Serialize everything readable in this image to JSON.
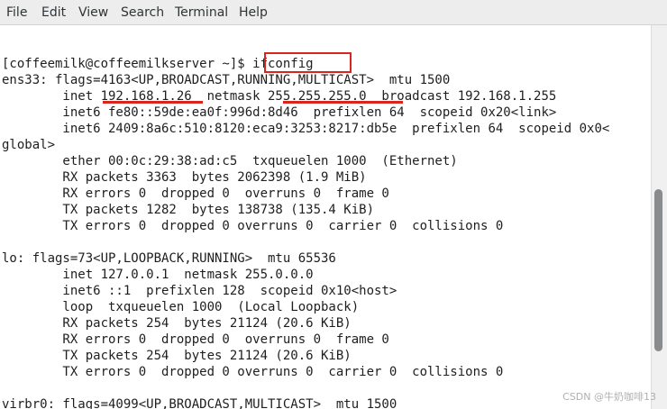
{
  "menubar": {
    "items": [
      "File",
      "Edit",
      "View",
      "Search",
      "Terminal",
      "Help"
    ]
  },
  "terminal": {
    "lines": [
      "",
      "[coffeemilk@coffeemilkserver ~]$ ifconfig",
      "ens33: flags=4163<UP,BROADCAST,RUNNING,MULTICAST>  mtu 1500",
      "        inet 192.168.1.26  netmask 255.255.255.0  broadcast 192.168.1.255",
      "        inet6 fe80::59de:ea0f:996d:8d46  prefixlen 64  scopeid 0x20<link>",
      "        inet6 2409:8a6c:510:8120:eca9:3253:8217:db5e  prefixlen 64  scopeid 0x0<",
      "global>",
      "        ether 00:0c:29:38:ad:c5  txqueuelen 1000  (Ethernet)",
      "        RX packets 3363  bytes 2062398 (1.9 MiB)",
      "        RX errors 0  dropped 0  overruns 0  frame 0",
      "        TX packets 1282  bytes 138738 (135.4 KiB)",
      "        TX errors 0  dropped 0 overruns 0  carrier 0  collisions 0",
      "",
      "lo: flags=73<UP,LOOPBACK,RUNNING>  mtu 65536",
      "        inet 127.0.0.1  netmask 255.0.0.0",
      "        inet6 ::1  prefixlen 128  scopeid 0x10<host>",
      "        loop  txqueuelen 1000  (Local Loopback)",
      "        RX packets 254  bytes 21124 (20.6 KiB)",
      "        RX errors 0  dropped 0  overruns 0  frame 0",
      "        TX packets 254  bytes 21124 (20.6 KiB)",
      "        TX errors 0  dropped 0 overruns 0  carrier 0  collisions 0",
      "",
      "virbr0: flags=4099<UP,BROADCAST,MULTICAST>  mtu 1500"
    ]
  },
  "annotations": {
    "command": "ifconfig",
    "inet_address": "192.168.1.26",
    "netmask": "255.255.255.0",
    "color": "#d9251d"
  },
  "watermark": "CSDN @牛奶咖啡13"
}
